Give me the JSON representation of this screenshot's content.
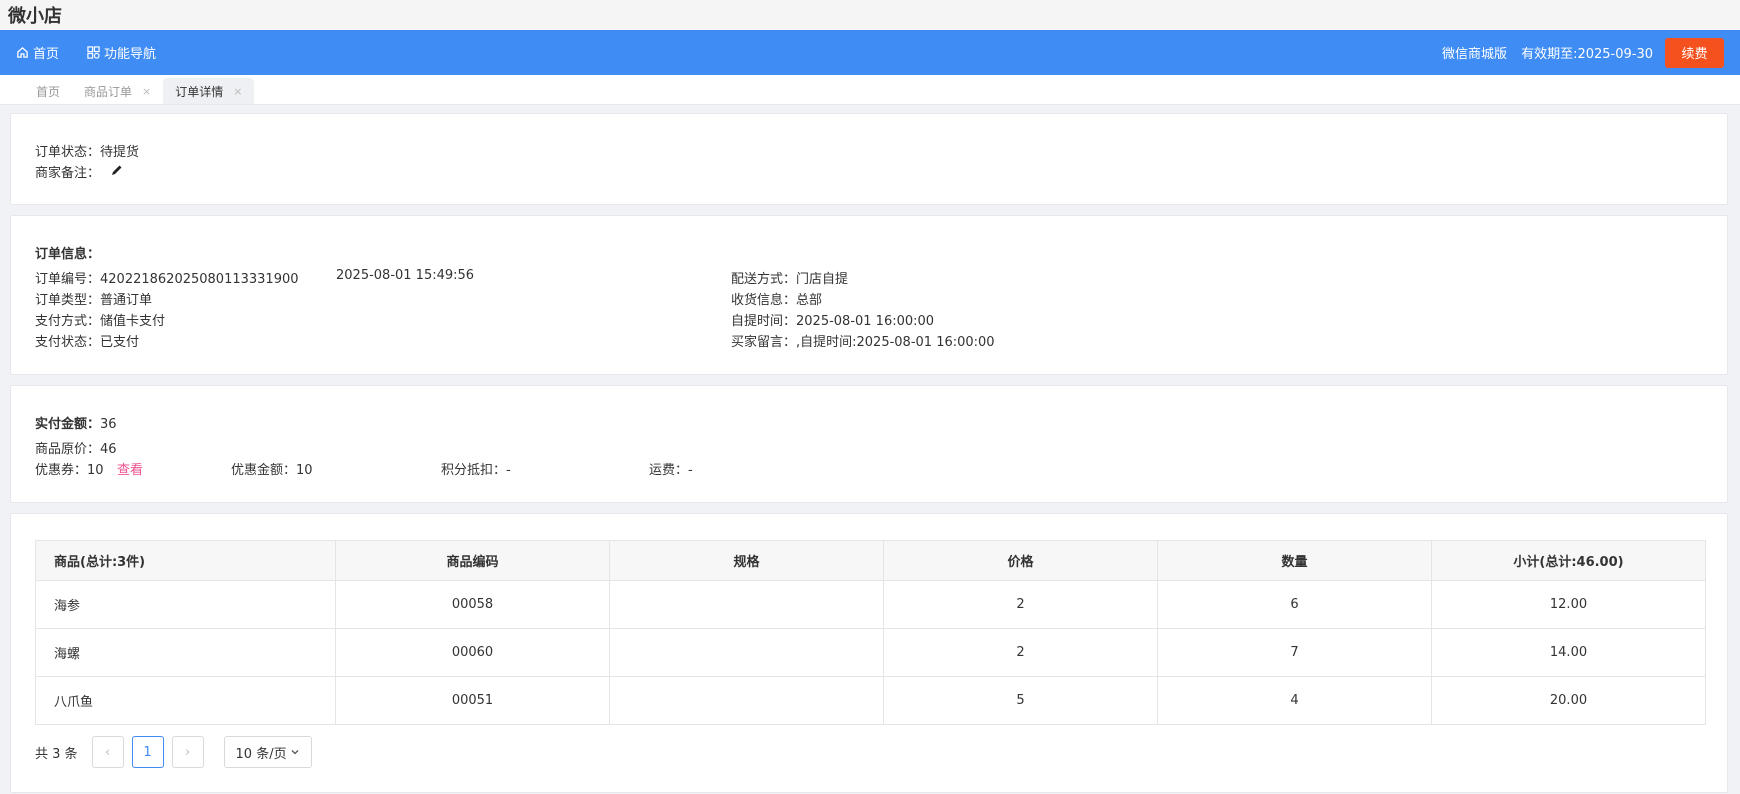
{
  "app": {
    "title": "微小店"
  },
  "topnav": {
    "home": "首页",
    "feature_nav": "功能导航",
    "edition": "微信商城版",
    "expiry": "有效期至:2025-09-30",
    "renew": "续费"
  },
  "tabs": [
    {
      "label": "首页",
      "closable": false
    },
    {
      "label": "商品订单",
      "closable": true
    },
    {
      "label": "订单详情",
      "closable": true,
      "active": true
    }
  ],
  "status_card": {
    "order_status": "订单状态：待提货",
    "merchant_note_label": "商家备注："
  },
  "order_info": {
    "heading": "订单信息：",
    "order_no": "订单编号：42022186202508011333190​0",
    "order_time": "2025-08-01 15:49:56",
    "order_type": "订单类型：普通订单",
    "pay_method": "支付方式：储值卡支付",
    "pay_status": "支付状态：已支付",
    "delivery": "配送方式：门店自提",
    "receiver": "收货信息：总部",
    "pickup_time": "自提时间：2025-08-01 16:00:00",
    "buyer_msg": "买家留言：,自提时间:2025-08-01 16:00:00"
  },
  "amount": {
    "paid_label": "实付金额：",
    "paid_value": "36",
    "original": "商品原价：46",
    "coupon": "优惠券：10",
    "coupon_view": "查看",
    "discount": "优惠金额：10",
    "points": "积分抵扣：-",
    "freight": "运费：-"
  },
  "table": {
    "headers": [
      "商品(总计:3件)",
      "商品编码",
      "规格",
      "价格",
      "数量",
      "小计(总计:46.00)"
    ],
    "rows": [
      [
        "海参",
        "00058",
        "",
        "2",
        "6",
        "12.00"
      ],
      [
        "海螺",
        "00060",
        "",
        "2",
        "7",
        "14.00"
      ],
      [
        "八爪鱼",
        "00051",
        "",
        "5",
        "4",
        "20.00"
      ]
    ]
  },
  "pager": {
    "total": "共 3 条",
    "prev": "‹",
    "page": "1",
    "next": "›",
    "page_size": "10 条/页"
  }
}
